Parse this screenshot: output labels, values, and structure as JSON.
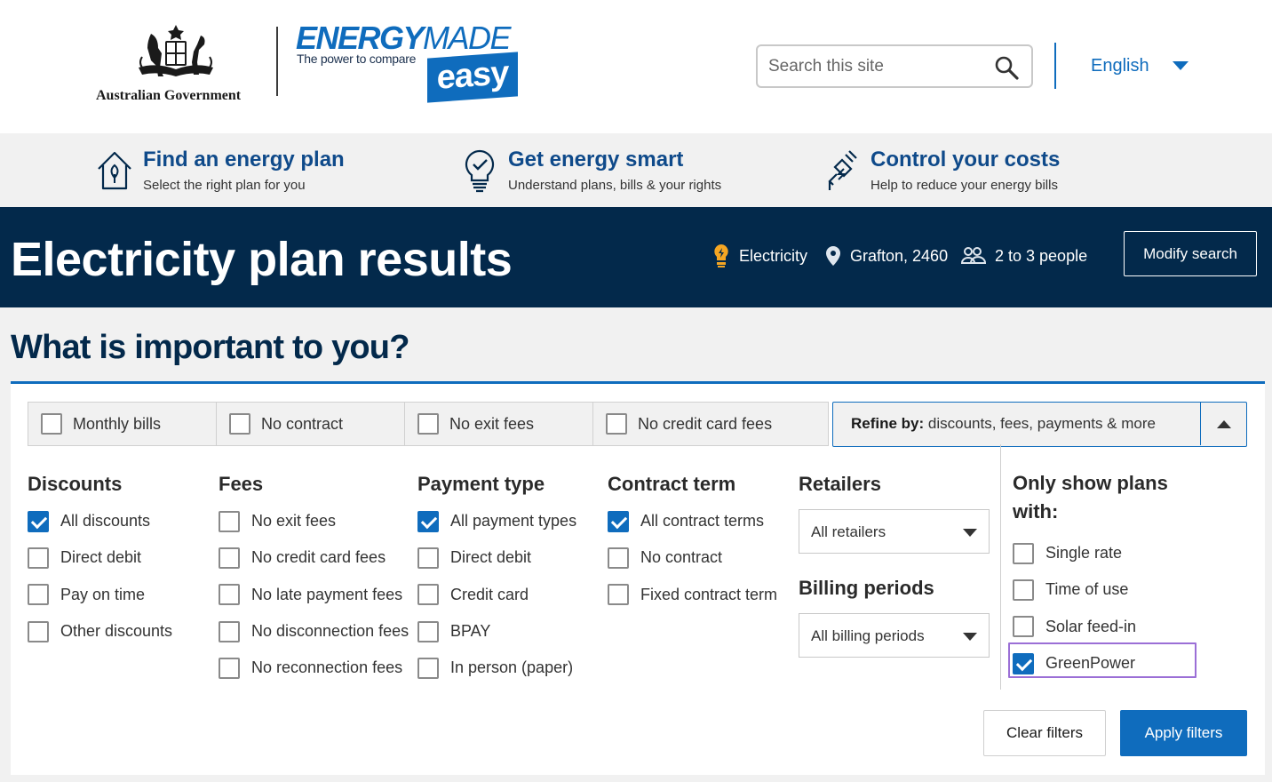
{
  "header": {
    "gov_logo_text": "Australian Government",
    "brand_energy": "ENERGY",
    "brand_made": "MADE",
    "brand_tagline": "The power to compare",
    "brand_easy": "easy",
    "search_placeholder": "Search this site",
    "search_icon": "search-icon",
    "language": "English"
  },
  "nav": {
    "items": [
      {
        "title": "Find an energy plan",
        "subtitle": "Select the right plan for you",
        "icon": "house-plug-icon"
      },
      {
        "title": "Get energy smart",
        "subtitle": "Understand plans, bills & your rights",
        "icon": "lightbulb-check-icon"
      },
      {
        "title": "Control your costs",
        "subtitle": "Help to reduce your energy bills",
        "icon": "plug-bolt-icon"
      }
    ]
  },
  "banner": {
    "title": "Electricity plan results",
    "fuel": "Electricity",
    "location": "Grafton, 2460",
    "household": "2 to 3 people",
    "modify_label": "Modify search",
    "fuel_color": "#f5a623"
  },
  "filters": {
    "title": "What is important to you?",
    "quick": [
      {
        "label": "Monthly bills",
        "checked": false
      },
      {
        "label": "No contract",
        "checked": false
      },
      {
        "label": "No exit fees",
        "checked": false
      },
      {
        "label": "No credit card fees",
        "checked": false
      }
    ],
    "refine_strong": "Refine by:",
    "refine_text": " discounts, fees, payments & more",
    "discounts": {
      "title": "Discounts",
      "options": [
        {
          "label": "All discounts",
          "checked": true
        },
        {
          "label": "Direct debit",
          "checked": false
        },
        {
          "label": "Pay on time",
          "checked": false
        },
        {
          "label": "Other discounts",
          "checked": false
        }
      ]
    },
    "fees": {
      "title": "Fees",
      "options": [
        {
          "label": "No exit fees",
          "checked": false
        },
        {
          "label": "No credit card fees",
          "checked": false
        },
        {
          "label": "No late payment fees",
          "checked": false
        },
        {
          "label": "No disconnection fees",
          "checked": false
        },
        {
          "label": "No reconnection fees",
          "checked": false
        }
      ]
    },
    "payment": {
      "title": "Payment type",
      "options": [
        {
          "label": "All payment types",
          "checked": true
        },
        {
          "label": "Direct debit",
          "checked": false
        },
        {
          "label": "Credit card",
          "checked": false
        },
        {
          "label": "BPAY",
          "checked": false
        },
        {
          "label": "In person (paper)",
          "checked": false
        }
      ]
    },
    "contract": {
      "title": "Contract term",
      "options": [
        {
          "label": "All contract terms",
          "checked": true
        },
        {
          "label": "No contract",
          "checked": false
        },
        {
          "label": "Fixed contract term",
          "checked": false
        }
      ]
    },
    "retailers": {
      "title": "Retailers",
      "selected": "All retailers"
    },
    "billing": {
      "title": "Billing periods",
      "selected": "All billing periods"
    },
    "show": {
      "title": "Only show plans with:",
      "options": [
        {
          "label": "Single rate",
          "checked": false
        },
        {
          "label": "Time of use",
          "checked": false
        },
        {
          "label": "Solar feed-in",
          "checked": false
        },
        {
          "label": "GreenPower",
          "checked": true
        }
      ]
    },
    "clear_label": "Clear filters",
    "apply_label": "Apply filters"
  },
  "colors": {
    "brand_blue": "#0f6cbd",
    "navy": "#03294b",
    "focus_outline": "#9b6fd6"
  }
}
